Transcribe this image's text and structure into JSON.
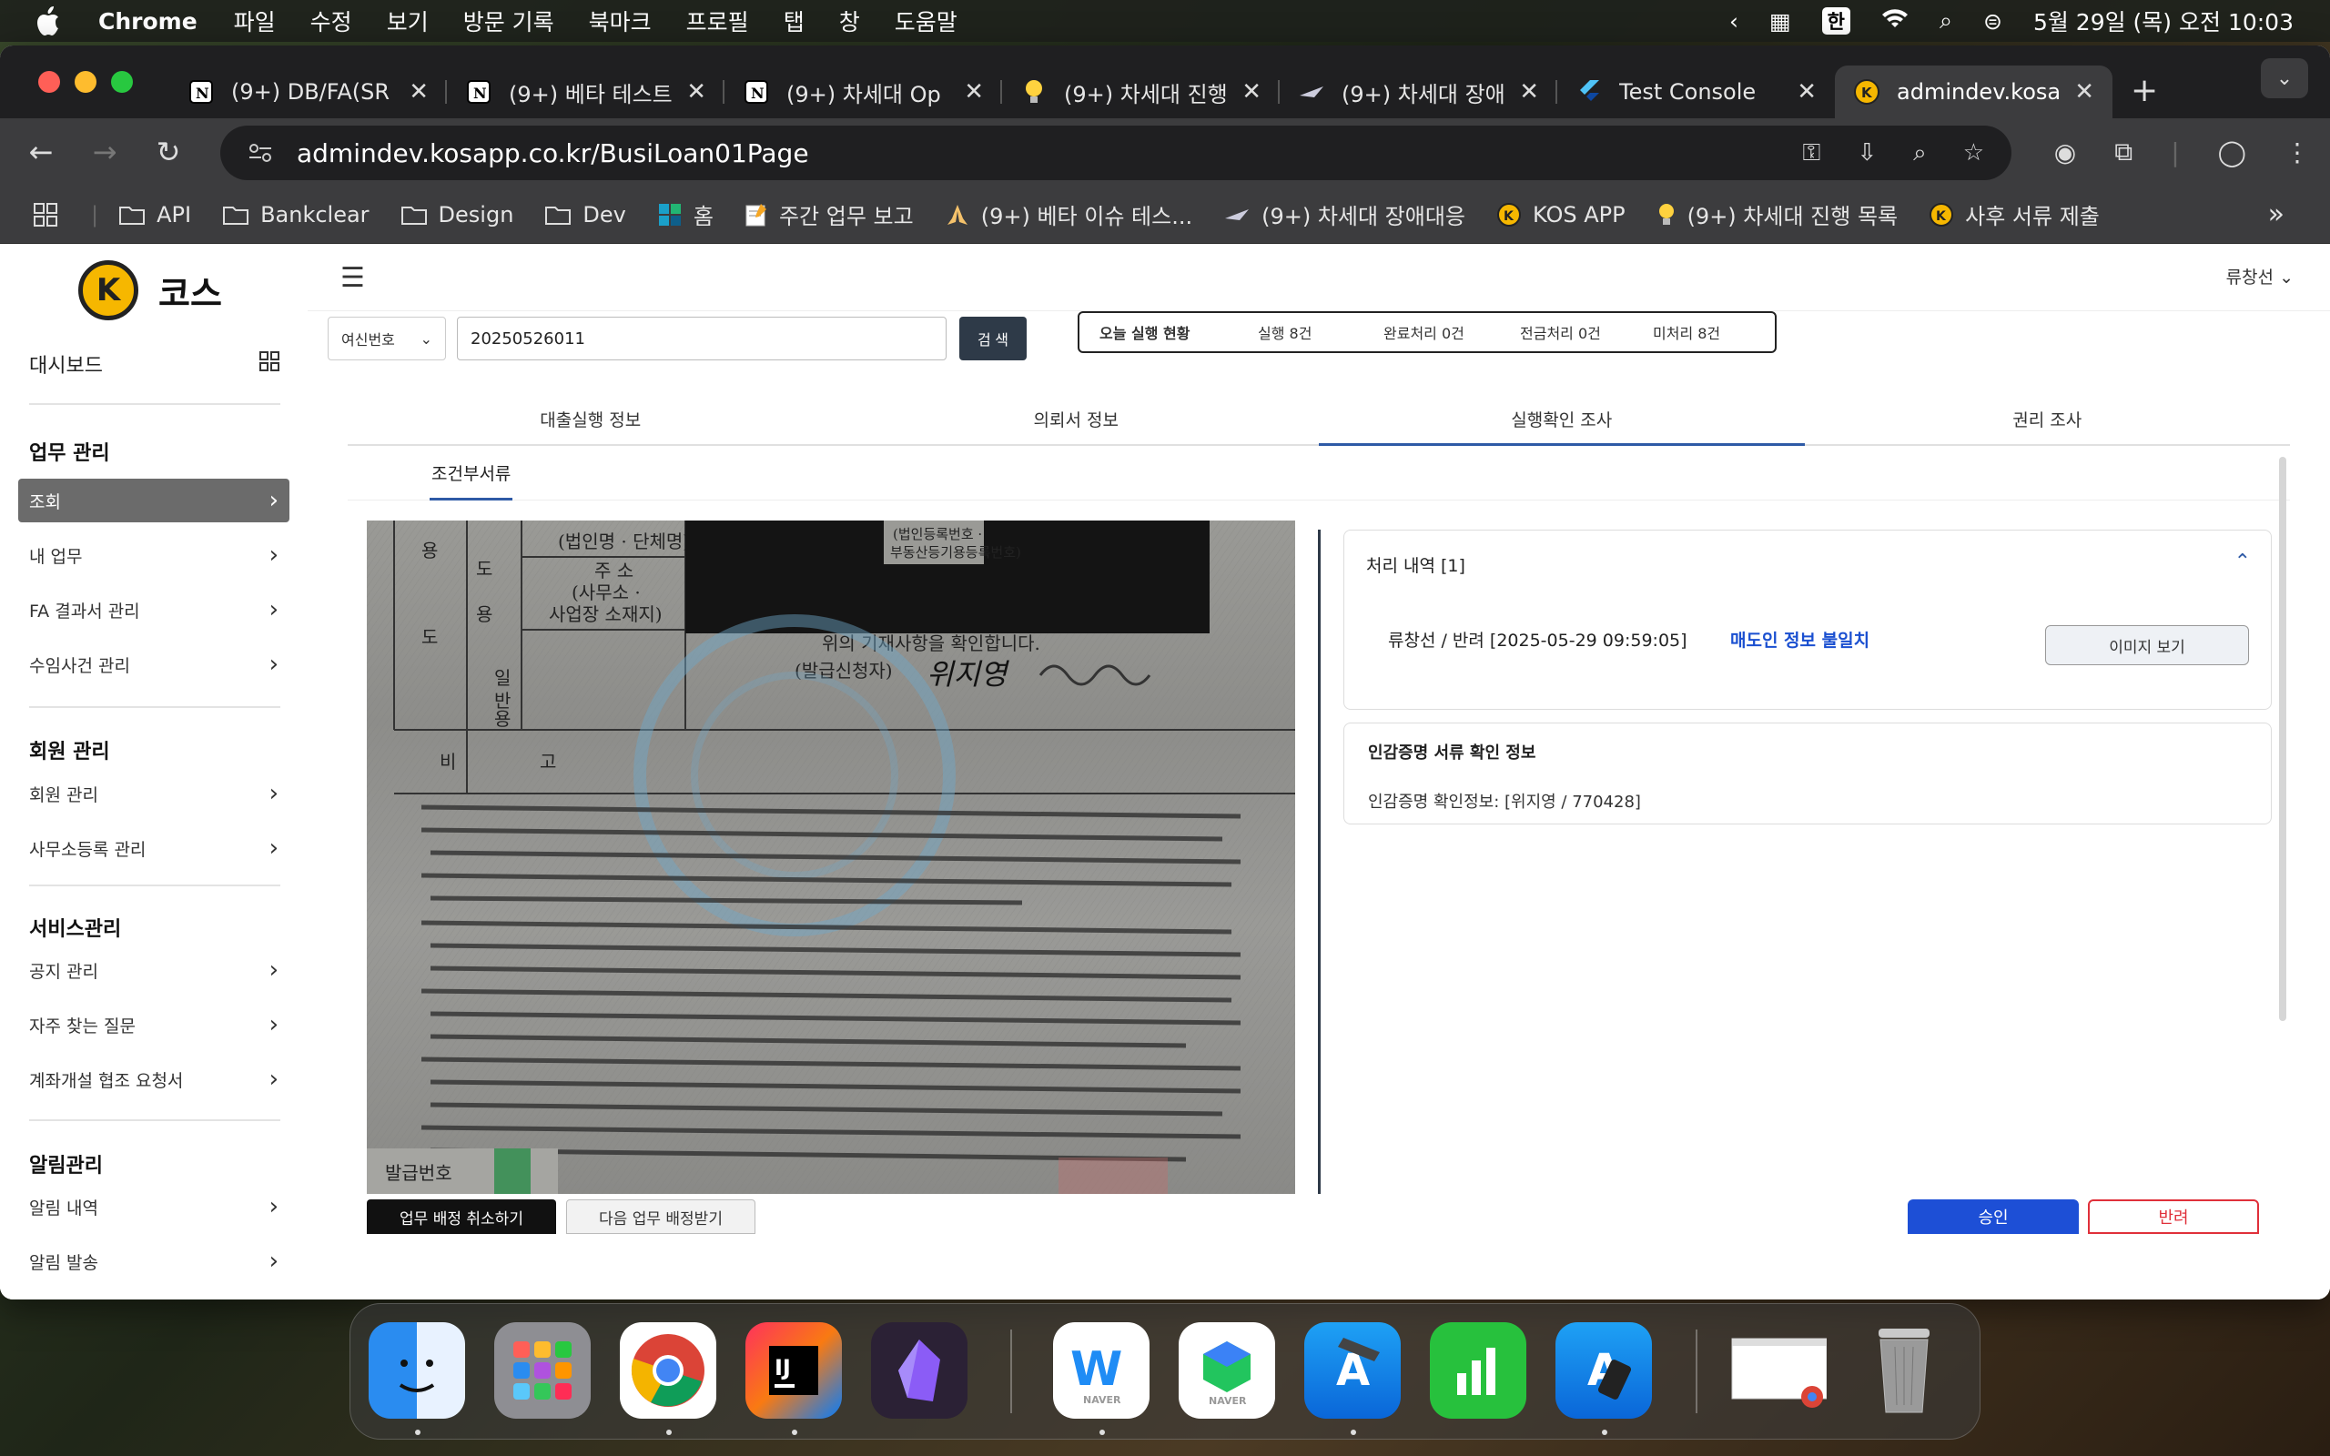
{
  "menubar": {
    "app_name": "Chrome",
    "menus": [
      "파일",
      "수정",
      "보기",
      "방문 기록",
      "북마크",
      "프로필",
      "탭",
      "창",
      "도움말"
    ],
    "input_source": "한",
    "datetime": "5월 29일 (목) 오전 10:03"
  },
  "browser": {
    "tabs": [
      {
        "title": "(9+) DB/FA(SR",
        "icon": "notion-icon"
      },
      {
        "title": "(9+) 베타 테스트",
        "icon": "notion-icon"
      },
      {
        "title": "(9+) 차세대 Op",
        "icon": "notion-icon"
      },
      {
        "title": "(9+) 차세대 진행",
        "icon": "lightbulb-icon"
      },
      {
        "title": "(9+) 차세대 장애",
        "icon": "jet-icon"
      },
      {
        "title": "Test Console",
        "icon": "flutter-icon"
      },
      {
        "title": "admindev.kosa",
        "icon": "kos-icon",
        "active": true
      }
    ],
    "url": "admindev.kosapp.co.kr/BusiLoan01Page",
    "bookmarks": [
      {
        "label": "API",
        "icon": "folder-icon"
      },
      {
        "label": "Bankclear",
        "icon": "folder-icon"
      },
      {
        "label": "Design",
        "icon": "folder-icon"
      },
      {
        "label": "Dev",
        "icon": "folder-icon"
      },
      {
        "label": "홈",
        "icon": "grid-color-icon"
      },
      {
        "label": "주간 업무 보고",
        "icon": "memo-icon"
      },
      {
        "label": "(9+) 베타 이슈 테스...",
        "icon": "pray-icon"
      },
      {
        "label": "(9+) 차세대 장애대응",
        "icon": "jet-icon"
      },
      {
        "label": "KOS APP",
        "icon": "kos-icon"
      },
      {
        "label": "(9+) 차세대 진행 목록",
        "icon": "lightbulb-icon"
      },
      {
        "label": "사후 서류 제출",
        "icon": "kos-icon"
      }
    ]
  },
  "app": {
    "logo_text": "코스",
    "logo_mark": "K",
    "user_name": "류창선",
    "sidebar": {
      "dashboard": "대시보드",
      "sections": [
        {
          "title": "업무 관리",
          "items": [
            "조회",
            "내 업무",
            "FA 결과서 관리",
            "수임사건 관리"
          ]
        },
        {
          "title": "회원 관리",
          "items": [
            "회원 관리",
            "사무소등록 관리"
          ]
        },
        {
          "title": "서비스관리",
          "items": [
            "공지 관리",
            "자주 찾는 질문",
            "계좌개설 협조 요청서"
          ]
        },
        {
          "title": "알림관리",
          "items": [
            "알림 내역",
            "알림 발송"
          ]
        }
      ],
      "active_item": "조회"
    },
    "search": {
      "select_label": "여신번호",
      "value": "20250526011",
      "button": "검 색"
    },
    "today_status": {
      "title": "오늘 실행 현황",
      "execute": "실행 8건",
      "done": "완료처리 0건",
      "transfer": "전금처리 0건",
      "pending": "미처리 8건"
    },
    "tabs": [
      "대출실행 정보",
      "의뢰서 정보",
      "실행확인 조사",
      "권리 조사"
    ],
    "active_tab": "실행확인 조사",
    "subtab": "조건부서류",
    "document": {
      "confirm_text": "위의 기재사항을 확인합니다.",
      "applicant_label": "(발급신청자)",
      "signature": "위지영",
      "remarks_label": "비 고"
    },
    "history": {
      "title": "처리 내역 [1]",
      "entry": "류창선 / 반려 [2025-05-29 09:59:05]",
      "reason": "매도인 정보 불일치",
      "image_button": "이미지 보기"
    },
    "seal_info": {
      "title": "인감증명 서류 확인 정보",
      "body": "인감증명 확인정보: [위지영 / 770428]"
    },
    "actions": {
      "cancel_assign": "업무 배정 취소하기",
      "next_assign": "다음 업무 배정받기",
      "approve": "승인",
      "reject": "반려"
    }
  },
  "colors": {
    "accent_blue": "#1d4fd6",
    "reject_red": "#e0303a",
    "logo_yellow": "#f6b700",
    "sidebar_active": "#6b6b6b"
  }
}
